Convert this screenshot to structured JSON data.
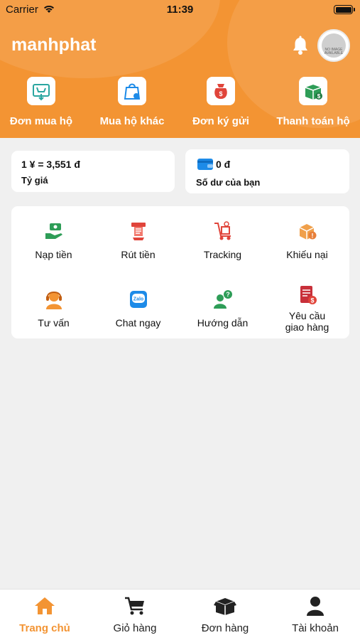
{
  "status_bar": {
    "carrier": "Carrier",
    "time": "11:39"
  },
  "header": {
    "title": "manhphat",
    "avatar_text": "NO IMAGE AVAILABLE"
  },
  "top_actions": [
    {
      "label": "Đơn mua hộ",
      "icon": "buy-order-icon"
    },
    {
      "label": "Mua hộ khác",
      "icon": "shopping-bag-icon"
    },
    {
      "label": "Đơn ký gửi",
      "icon": "consignment-icon"
    },
    {
      "label": "Thanh toán hộ",
      "icon": "payment-box-icon"
    }
  ],
  "rate": {
    "value": "1 ¥ = 3,551 đ",
    "label": "Tỷ giá"
  },
  "balance": {
    "value": "0 đ",
    "label": "Số dư của bạn"
  },
  "services": [
    {
      "label": "Nạp tiền",
      "icon": "deposit-icon"
    },
    {
      "label": "Rút tiền",
      "icon": "withdraw-icon"
    },
    {
      "label": "Tracking",
      "icon": "tracking-icon"
    },
    {
      "label": "Khiếu nại",
      "icon": "complaint-icon"
    },
    {
      "label": "Tư vấn",
      "icon": "consult-icon"
    },
    {
      "label": "Chat ngay",
      "icon": "zalo-chat-icon"
    },
    {
      "label": "Hướng dẫn",
      "icon": "guide-icon"
    },
    {
      "label": "Yêu cầu giao hàng",
      "icon": "delivery-request-icon"
    }
  ],
  "tabs": [
    {
      "label": "Trang chủ",
      "icon": "home-icon",
      "active": true
    },
    {
      "label": "Giỏ hàng",
      "icon": "cart-icon",
      "active": false
    },
    {
      "label": "Đơn hàng",
      "icon": "orders-box-icon",
      "active": false
    },
    {
      "label": "Tài khoản",
      "icon": "user-icon",
      "active": false
    }
  ],
  "colors": {
    "primary": "#f39433",
    "background": "#f0f0f0",
    "green": "#2e9d57",
    "red": "#e0443a",
    "blue": "#1d8be8"
  }
}
